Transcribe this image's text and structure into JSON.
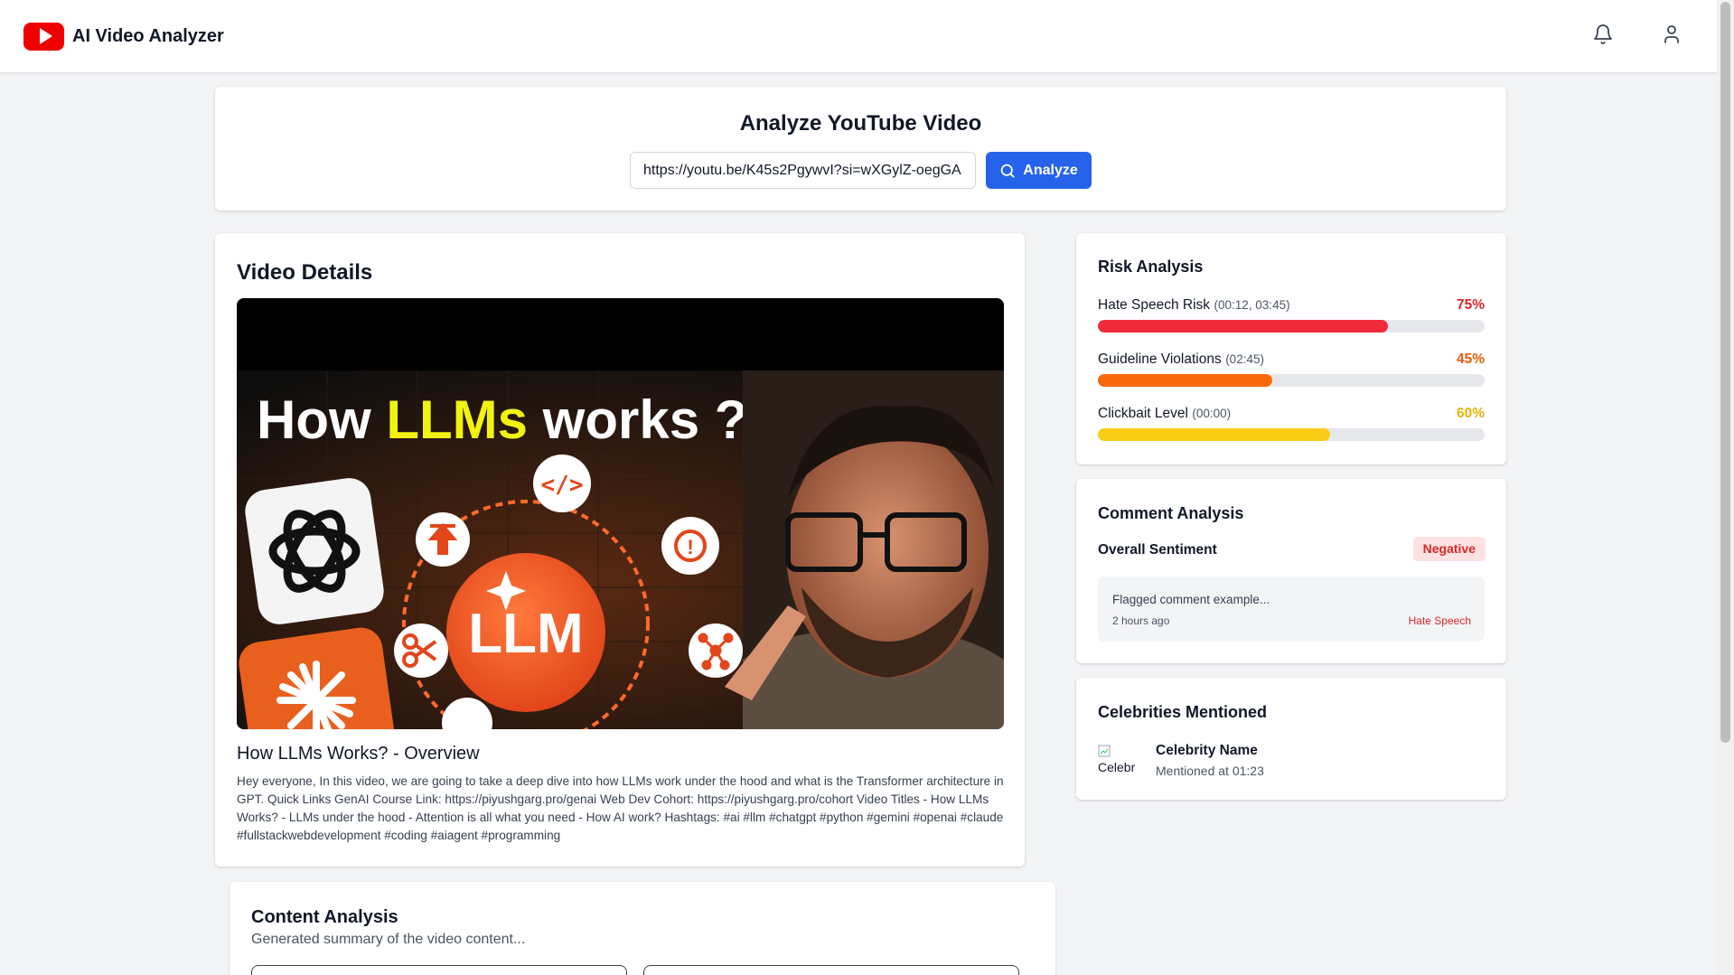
{
  "header": {
    "app_title": "AI Video Analyzer",
    "icons": [
      "youtube-logo-icon",
      "bell-icon",
      "user-icon"
    ]
  },
  "analyze": {
    "title": "Analyze YouTube Video",
    "url_value": "https://youtu.be/K45s2PgywvI?si=wXGylZ-oegGA",
    "button_label": "Analyze"
  },
  "video": {
    "section_title": "Video Details",
    "thumbnail": {
      "headline_part1": "How ",
      "headline_part2": "LLMs",
      "headline_part3": " works ?",
      "center_label": "LLM"
    },
    "title": "How LLMs Works? - Overview",
    "description": "Hey everyone, In this video, we are going to take a deep dive into how LLMs work under the hood and what is the Transformer architecture in GPT. Quick Links GenAI Course Link: https://piyushgarg.pro/genai Web Dev Cohort: https://piyushgarg.pro/cohort Video Titles - How LLMs Works? - LLMs under the hood - Attention is all what you need - How AI work? Hashtags: #ai #llm #chatgpt #python #gemini #openai #claude #fullstackwebdevelopment #coding #aiagent #programming"
  },
  "risk": {
    "title": "Risk Analysis",
    "items": [
      {
        "label": "Hate Speech Risk",
        "timestamps": "(00:12, 03:45)",
        "percent_text": "75%",
        "value": 0.75,
        "color": "#ef2b3b",
        "text_color": "#dc2626"
      },
      {
        "label": "Guideline Violations",
        "timestamps": "(02:45)",
        "percent_text": "45%",
        "value": 0.45,
        "color": "#f9680b",
        "text_color": "#ea580c"
      },
      {
        "label": "Clickbait Level",
        "timestamps": "(00:00)",
        "percent_text": "60%",
        "value": 0.6,
        "color": "#facc15",
        "text_color": "#eab308"
      }
    ]
  },
  "comments": {
    "title": "Comment Analysis",
    "sentiment_label": "Overall Sentiment",
    "sentiment_value": "Negative",
    "flagged": {
      "text": "Flagged comment example...",
      "time": "2 hours ago",
      "tag": "Hate Speech"
    }
  },
  "celebrities": {
    "title": "Celebrities Mentioned",
    "items": [
      {
        "avatar_alt": "Celebr",
        "name": "Celebrity Name",
        "mentioned": "Mentioned at 01:23"
      }
    ]
  },
  "content_analysis": {
    "title": "Content Analysis",
    "subtitle": "Generated summary of the video content..."
  }
}
